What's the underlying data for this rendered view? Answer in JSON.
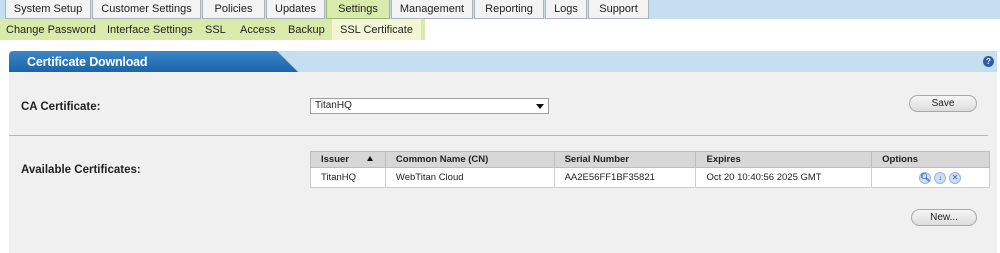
{
  "top_tabs": [
    {
      "label": "System Setup"
    },
    {
      "label": "Customer Settings"
    },
    {
      "label": "Policies"
    },
    {
      "label": "Updates"
    },
    {
      "label": "Settings",
      "active": true
    },
    {
      "label": "Management"
    },
    {
      "label": "Reporting"
    },
    {
      "label": "Logs"
    },
    {
      "label": "Support"
    }
  ],
  "sub_nav": [
    {
      "label": "Change Password"
    },
    {
      "label": "Interface Settings"
    },
    {
      "label": "SSL"
    },
    {
      "label": "Access"
    },
    {
      "label": "Backup"
    },
    {
      "label": "SSL Certificate",
      "active": true
    }
  ],
  "panel": {
    "title": "Certificate Download",
    "help_icon": "help-icon"
  },
  "ca_certificate": {
    "label": "CA Certificate:",
    "selected": "TitanHQ",
    "save_label": "Save"
  },
  "available": {
    "label": "Available Certificates:",
    "columns": [
      "Issuer",
      "Common Name (CN)",
      "Serial Number",
      "Expires",
      "Options"
    ],
    "rows": [
      {
        "issuer": "TitanHQ",
        "cn": "WebTitan Cloud",
        "serial": "AA2E56FF1BF35821",
        "expires": "Oct 20 10:40:56 2025 GMT"
      }
    ],
    "option_icons": [
      "view-icon",
      "download-icon",
      "delete-icon"
    ],
    "new_label": "New..."
  },
  "colors": {
    "tab_bar": "#c5def0",
    "active_tab": "#d8ebab",
    "panel_header": "#1f6fb5",
    "panel_bg": "#f0f0f0"
  }
}
